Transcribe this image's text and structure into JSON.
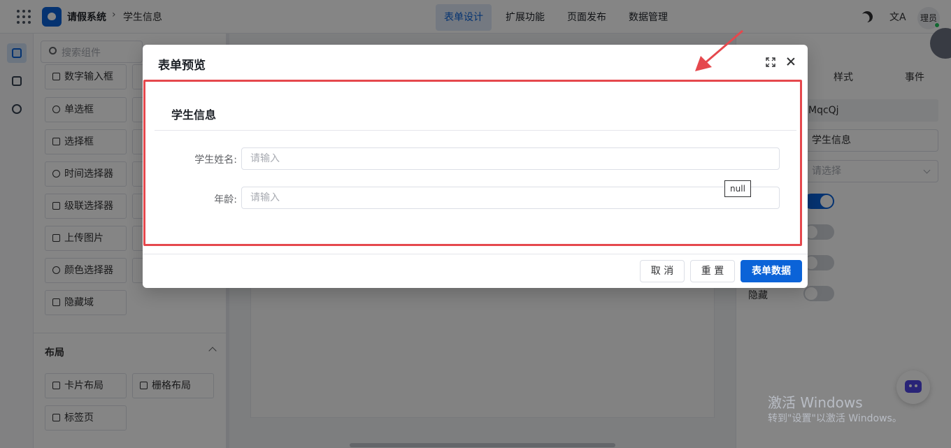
{
  "header": {
    "app_name": "请假系统",
    "breadcrumb_sep": "›",
    "page_name": "学生信息",
    "nav_tabs": [
      "表单设计",
      "扩展功能",
      "页面发布",
      "数据管理"
    ],
    "active_tab": "表单设计",
    "translate_glyph": "文A",
    "user_avatar": "理员"
  },
  "components": {
    "search_placeholder": "搜索组件",
    "items": [
      "数字输入框",
      "单选框",
      "选择框",
      "时间选择器",
      "级联选择器",
      "上传图片",
      "颜色选择器",
      "隐藏域"
    ],
    "layout_section_title": "布局",
    "layout_items": [
      "卡片布局",
      "栅格布局",
      "标签页"
    ]
  },
  "props_panel": {
    "tabs": [
      "样式",
      "事件"
    ],
    "id_value": "MqcQj",
    "title_value": "学生信息",
    "select_placeholder": "请选择",
    "toggles_on": [
      true,
      false,
      false,
      false
    ],
    "hide_label": "隐藏"
  },
  "watermark": {
    "line1": "激活 Windows",
    "line2": "转到\"设置\"以激活 Windows。"
  },
  "dialog": {
    "title": "表单预览",
    "card_title": "学生信息",
    "fields": [
      {
        "label": "学生姓名:",
        "placeholder": "请输入"
      },
      {
        "label": "年龄:",
        "placeholder": "请输入"
      }
    ],
    "tooltip": "null",
    "buttons": {
      "cancel": "取 消",
      "reset": "重 置",
      "submit": "表单数据"
    }
  },
  "colors": {
    "primary": "#0b63d8",
    "highlight_frame": "#e5484d",
    "arrow": "#e5484d"
  }
}
